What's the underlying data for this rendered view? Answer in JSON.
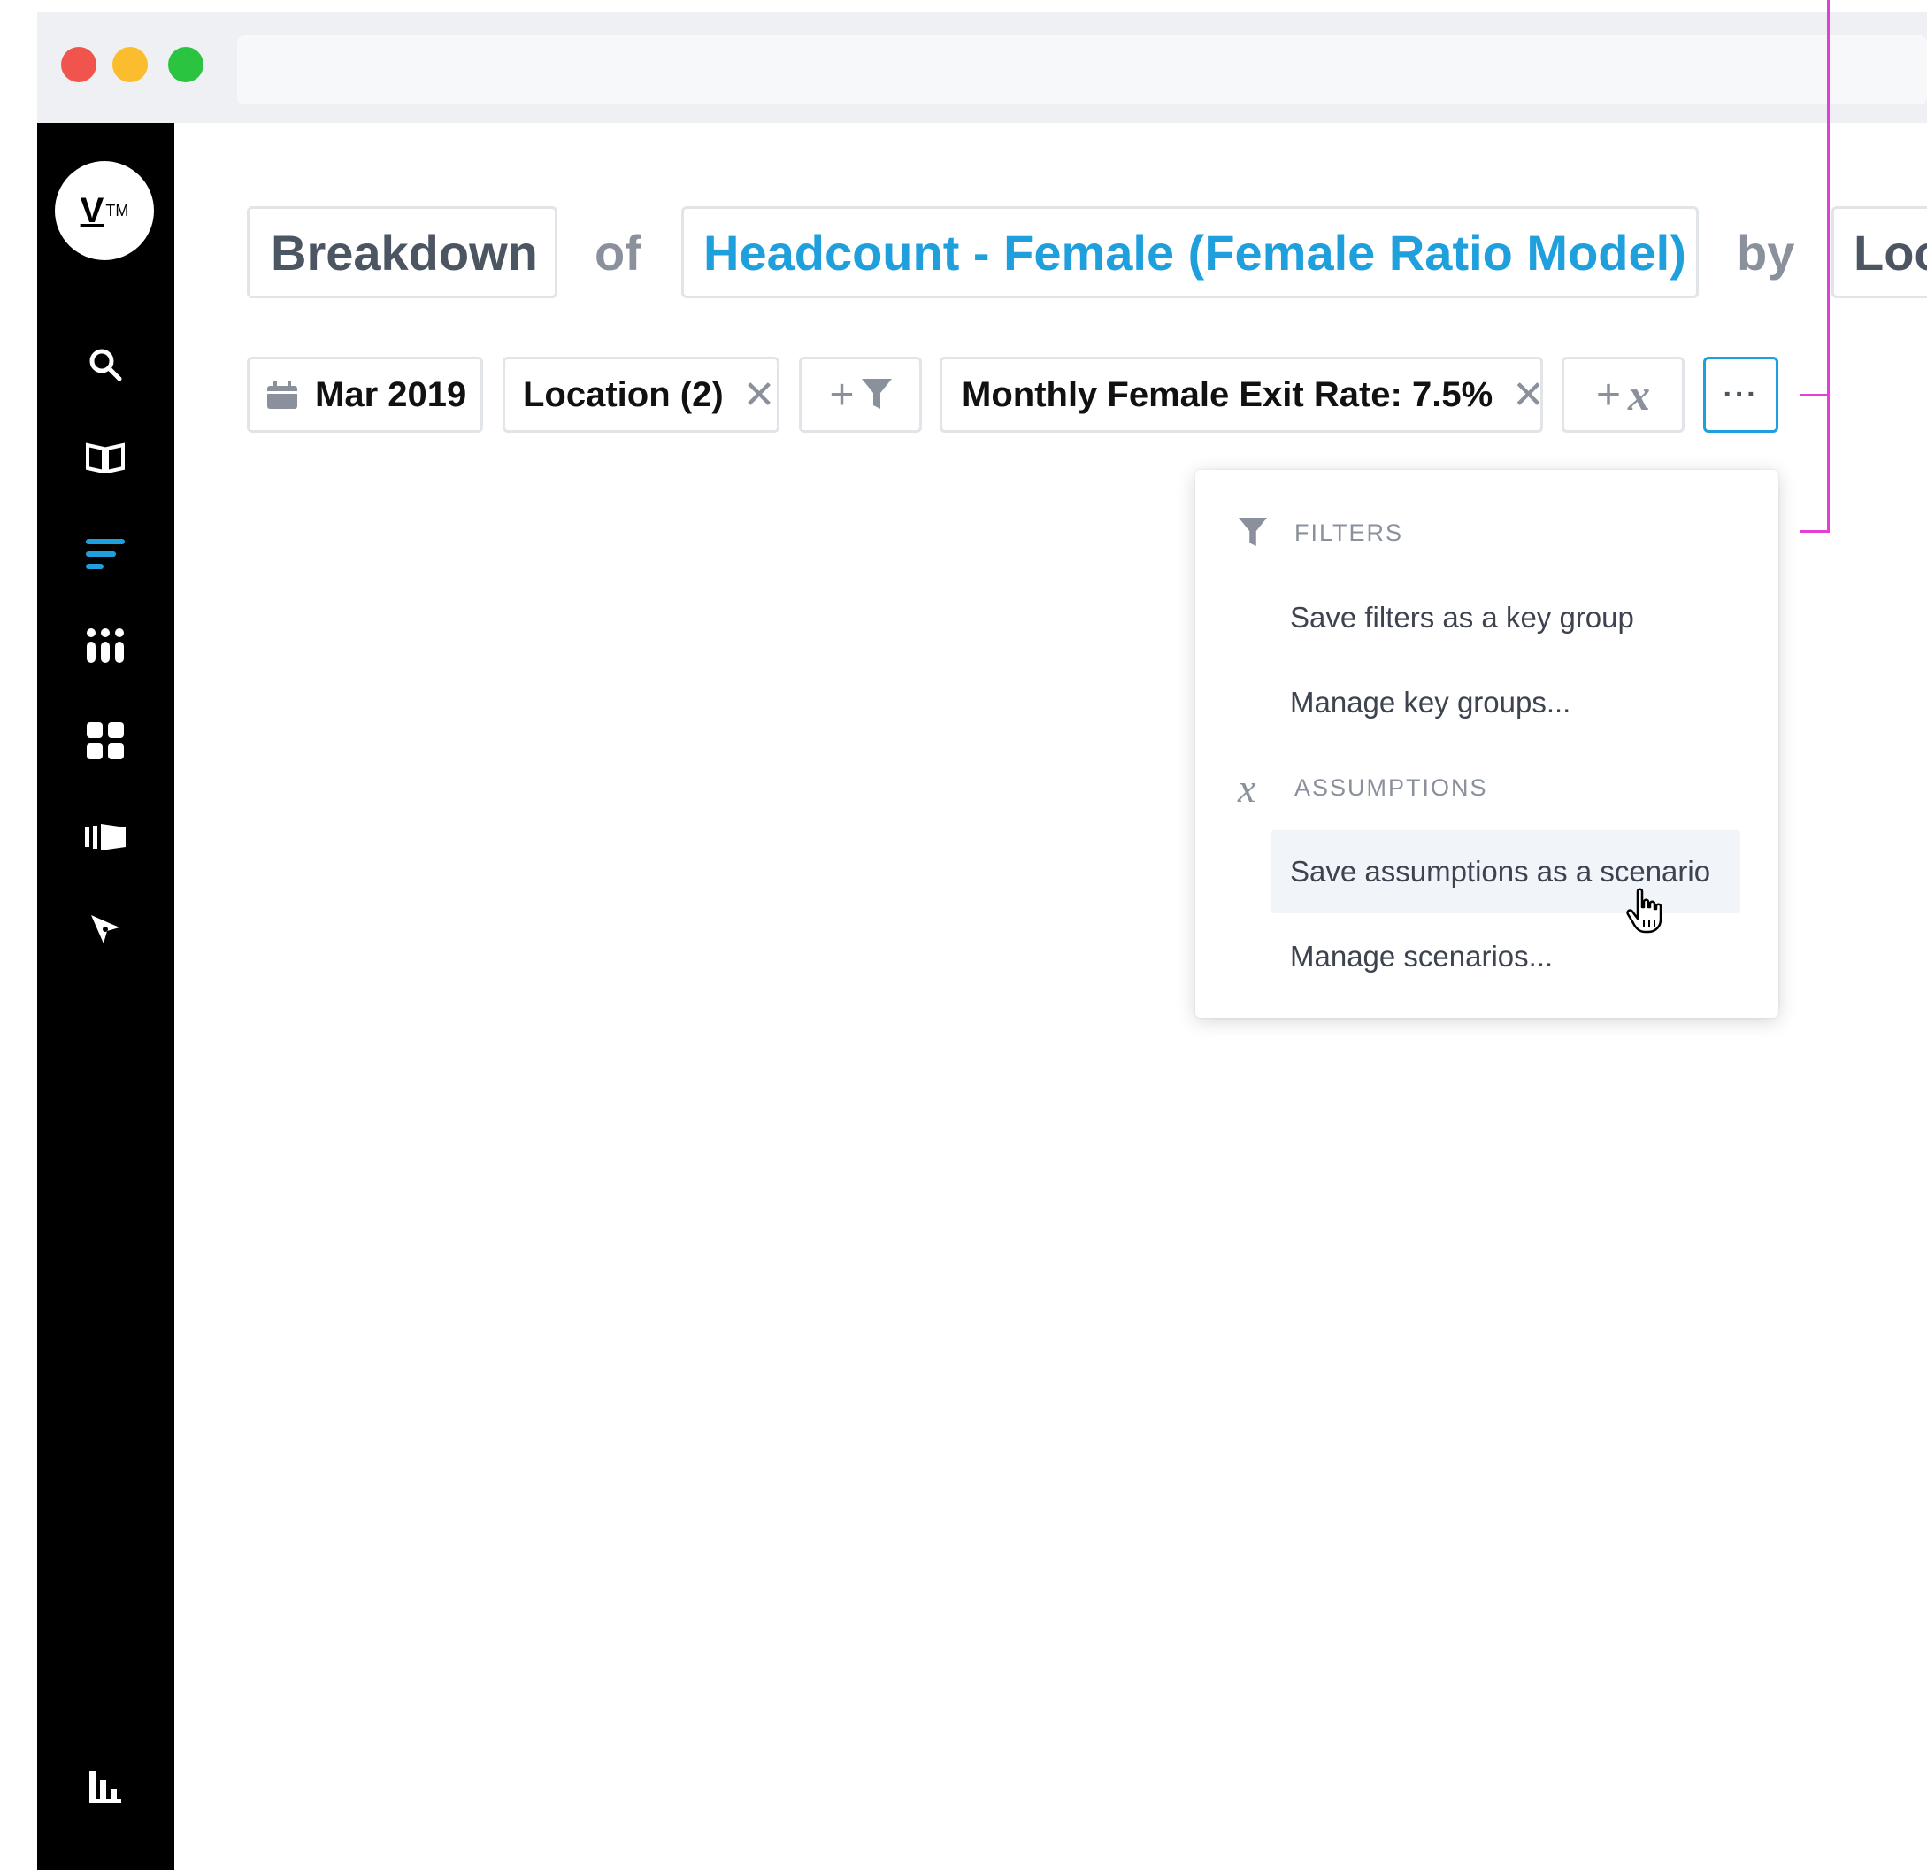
{
  "window": {
    "traffic_lights": [
      "#f0544c",
      "#fbbd2e",
      "#2ac440"
    ]
  },
  "sidebar": {
    "logo_text": "V",
    "logo_mark": "TM",
    "items": [
      {
        "icon": "search-icon"
      },
      {
        "icon": "book-icon"
      },
      {
        "icon": "breakdown-lines-icon",
        "active": true,
        "color": "#1f9fdc"
      },
      {
        "icon": "people-icon"
      },
      {
        "icon": "dashboard-grid-icon"
      },
      {
        "icon": "storyboard-icon"
      },
      {
        "icon": "compass-icon"
      },
      {
        "icon": "bar-chart-icon"
      }
    ]
  },
  "query": {
    "breakdown": "Breakdown",
    "of": "of",
    "metric": "Headcount - Female (Female Ratio Model)",
    "metric_color": "#1f9fdc",
    "by": "by",
    "dimension": "Loc"
  },
  "chips": {
    "date": "Mar 2019",
    "filter": "Location (2)",
    "assumption": "Monthly Female Exit Rate: 7.5%",
    "more": "···"
  },
  "dropdown": {
    "filters_header": "FILTERS",
    "filters_items": [
      "Save filters as a key group",
      "Manage key groups..."
    ],
    "assumptions_header": "ASSUMPTIONS",
    "assumptions_items": [
      "Save assumptions as a scenario",
      "Manage scenarios..."
    ]
  },
  "accent_color": "#e13fd6"
}
